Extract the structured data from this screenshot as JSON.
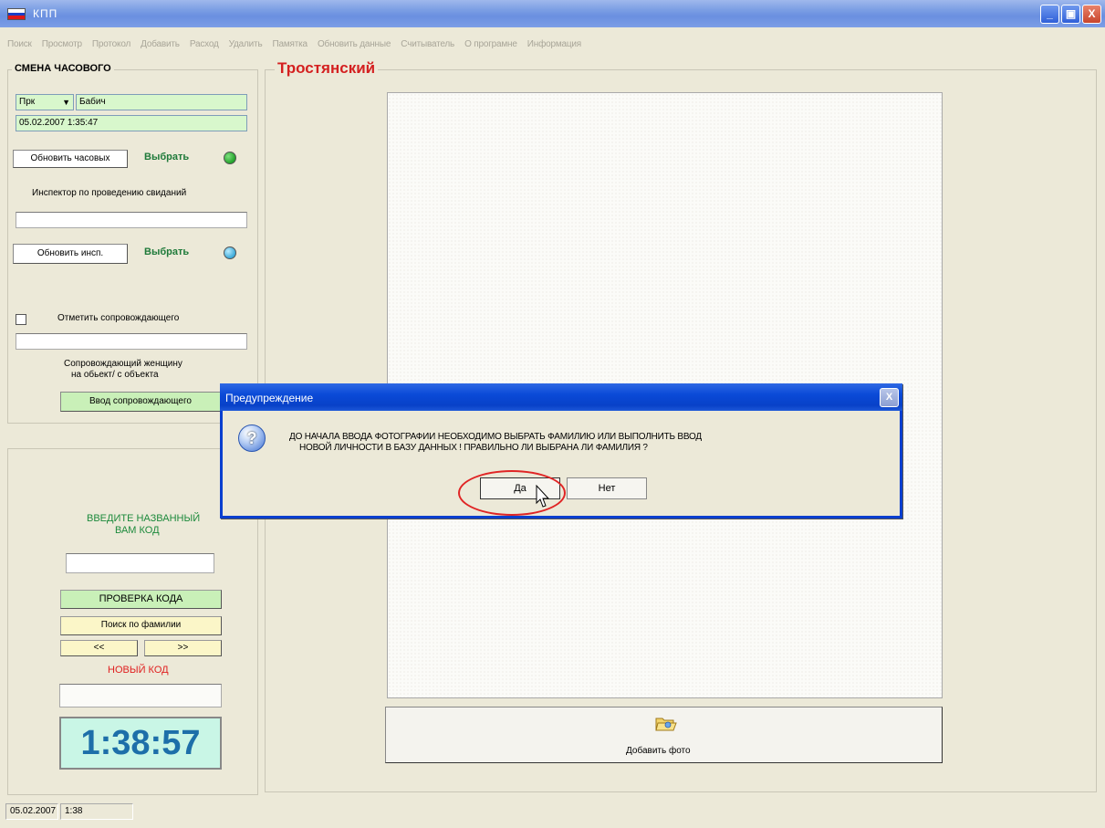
{
  "window": {
    "title": "КПП",
    "min_glyph": "_",
    "max_glyph": "▣",
    "close_glyph": "X"
  },
  "menu": [
    "Поиск",
    "Просмотр",
    "Протокол",
    "Добавить",
    "Расход",
    "Удалить",
    "Памятка",
    "Обновить данные",
    "Считыватель",
    "О програмне",
    "Информация"
  ],
  "shift": {
    "legend": "СМЕНА ЧАСОВОГО",
    "post_select": "Прк",
    "guard_name": "Бабич",
    "datetime": "05.02.2007 1:35:47",
    "refresh_guards_label": "Обновить часовых",
    "choose_label_1": "Выбрать",
    "inspector_label": "Инспектор по проведению свиданий",
    "inspector_value": "",
    "refresh_insp_label": "Обновить инсп.",
    "choose_label_2": "Выбрать",
    "mark_escort_label": "Отметить сопровождающего",
    "escort_value": "",
    "escort_note_line1": "Сопровождающий женщину",
    "escort_note_line2": "на обьект/ с объекта",
    "escort_button": "Ввод сопровождающего"
  },
  "code_panel": {
    "prompt_line1": "ВВЕДИТЕ НАЗВАННЫЙ",
    "prompt_line2": "ВАМ КОД",
    "code_value": "",
    "check_code_button": "ПРОВЕРКА КОДА",
    "search_surname_button": "Поиск по фамилии",
    "prev_button": "<<",
    "next_button": ">>",
    "new_code_label": "НОВЫЙ КОД",
    "new_code_value": "",
    "clock": "1:38:57"
  },
  "person": {
    "title": "Тростянский",
    "add_photo_label": "Добавить фото"
  },
  "statusbar": {
    "date": "05.02.2007",
    "time": "1:38"
  },
  "dialog": {
    "title": "Предупреждение",
    "message_line1": "ДО НАЧАЛА ВВОДА ФОТОГРАФИИ НЕОБХОДИМО ВЫБРАТЬ ФАМИЛИЮ ИЛИ ВЫПОЛНИТЬ ВВОД",
    "message_line2": "НОВОЙ ЛИЧНОСТИ В БАЗУ ДАННЫХ !   ПРАВИЛЬНО ЛИ ВЫБРАНА ЛИ ФАМИЛИЯ ?",
    "yes_button": "Да",
    "no_button": "Нет",
    "close_glyph": "X",
    "icon_glyph": "?"
  },
  "colors": {
    "accent_title": "#d42020",
    "led_green": "#22a22a",
    "led_blue": "#3ba9d8",
    "new_code_red": "#e02020",
    "prompt_green": "#1d8a3c"
  }
}
